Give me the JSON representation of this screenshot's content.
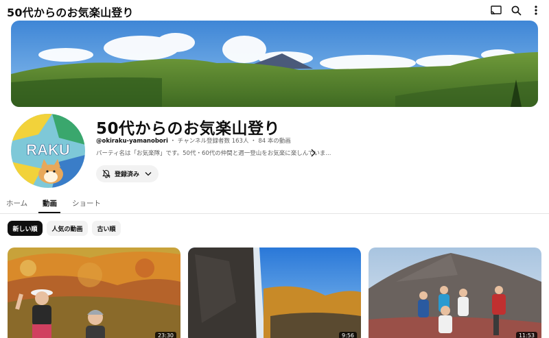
{
  "header": {
    "title": "50代からのお気楽山登り",
    "icons": [
      "cast-icon",
      "search-icon",
      "more-vert-icon"
    ]
  },
  "channel": {
    "name": "50代からのお気楽山登り",
    "handle": "@okiraku-yamanobori",
    "separator": "・",
    "subscribers": "チャンネル登録者数 163人",
    "videos": "84 本の動画",
    "description": "パーティ名は「お気楽隊」です。50代・60代の仲間と週一登山をお気楽に楽しんでいま...",
    "avatar_text": "RAKU",
    "subscribe_label": "登録済み"
  },
  "tabs": [
    {
      "label": "ホーム",
      "active": false
    },
    {
      "label": "動画",
      "active": true
    },
    {
      "label": "ショート",
      "active": false
    }
  ],
  "chips": [
    {
      "label": "新しい順",
      "selected": true
    },
    {
      "label": "人気の動画",
      "selected": false
    },
    {
      "label": "古い順",
      "selected": false
    }
  ],
  "videos": [
    {
      "duration": "23:30",
      "scene": "autumn-hikers"
    },
    {
      "duration": "9:56",
      "scene": "waterfall-cliff"
    },
    {
      "duration": "11:53",
      "scene": "volcano-summit-group"
    }
  ],
  "colors": {
    "text_primary": "#0f0f0f",
    "text_secondary": "#606060",
    "chip_bg": "#f2f2f2",
    "chip_selected_bg": "#0f0f0f"
  }
}
